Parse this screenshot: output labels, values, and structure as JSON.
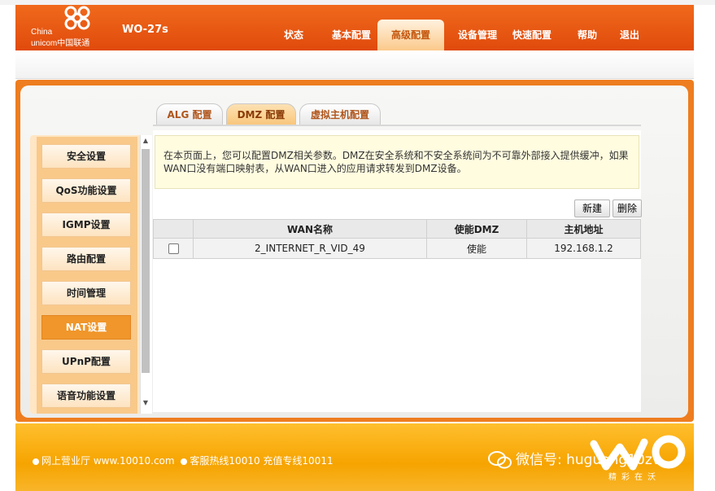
{
  "header": {
    "logo_line1": "China",
    "logo_line2": "unicom中国联通",
    "model": "WO-27s",
    "nav": [
      {
        "label": "状态"
      },
      {
        "label": "基本配置"
      },
      {
        "label": "高级配置"
      },
      {
        "label": "设备管理"
      },
      {
        "label": "快速配置"
      },
      {
        "label": "帮助"
      },
      {
        "label": "退出"
      }
    ],
    "active_nav": "高级配置"
  },
  "tabs": [
    {
      "label": "ALG 配置"
    },
    {
      "label": "DMZ 配置"
    },
    {
      "label": "虚拟主机配置"
    }
  ],
  "active_tab": "DMZ 配置",
  "sidebar": {
    "items": [
      {
        "label": "安全设置"
      },
      {
        "label": "QoS功能设置"
      },
      {
        "label": "IGMP设置"
      },
      {
        "label": "路由配置"
      },
      {
        "label": "时间管理"
      },
      {
        "label": "NAT设置"
      },
      {
        "label": "UPnP配置"
      },
      {
        "label": "语音功能设置"
      }
    ],
    "active": "NAT设置"
  },
  "main": {
    "notice": "在本页面上，您可以配置DMZ相关参数。DMZ在安全系统和不安全系统间为不可靠外部接入提供缓冲，如果WAN口没有端口映射表，从WAN口进入的应用请求转发到DMZ设备。",
    "buttons": {
      "new": "新建",
      "delete": "删除"
    },
    "table": {
      "headers": [
        "",
        "WAN名称",
        "使能DMZ",
        "主机地址"
      ],
      "rows": [
        {
          "checked": false,
          "wan_name": "2_INTERNET_R_VID_49",
          "enable": "使能",
          "host": "192.168.1.2"
        }
      ]
    }
  },
  "footer": {
    "links": "网上营业厅  www.10010.com",
    "hotline": "客服热线10010  充值专线10011",
    "wechat": "微信号: huguang10zv",
    "slogan": "精彩在沃"
  },
  "colors": {
    "brand_orange": "#e8561a",
    "frame_orange": "#ee7d1f",
    "footer_yellow": "#f6a400"
  }
}
